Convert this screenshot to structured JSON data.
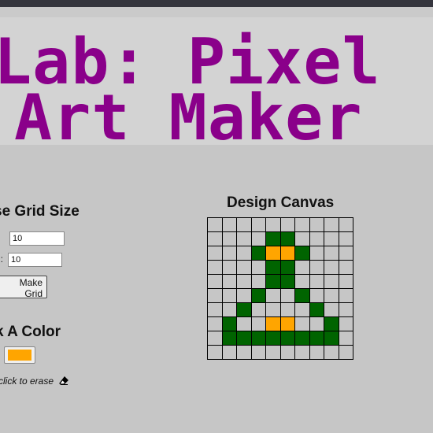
{
  "header": {
    "title_line1": "Lab: Pixel",
    "title_line2": "Art Maker"
  },
  "grid_form": {
    "heading": "se Grid Size",
    "height_value": "10",
    "width_label": "n:",
    "width_value": "10",
    "submit_label": "Make Grid"
  },
  "color_form": {
    "heading": "k A Color",
    "selected_color": "#ffa500",
    "hint": "click to erase",
    "eraser_icon": "eraser"
  },
  "canvas": {
    "heading": "Design Canvas",
    "rows": 10,
    "cols": 10,
    "palette": {
      ".": "#c6c6c6",
      "G": "#006400",
      "O": "#ffa500"
    },
    "pixels": [
      "..........",
      "....GG....",
      "...GOOG...",
      "....GG....",
      "....GG....",
      "...G..G...",
      "..G....G..",
      ".G..OO..G.",
      ".GGGGGGGG.",
      ".........."
    ]
  }
}
